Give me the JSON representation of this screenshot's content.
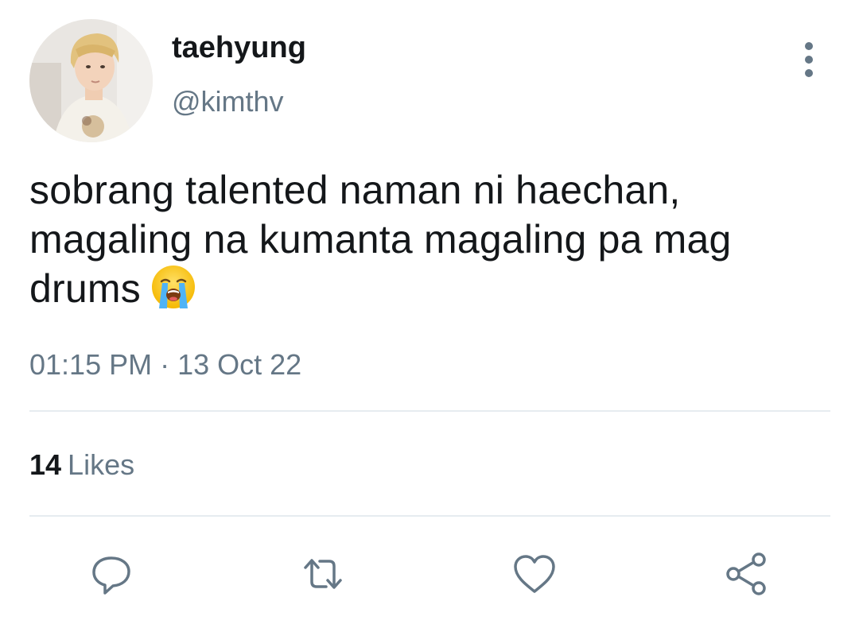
{
  "tweet": {
    "author": {
      "display_name": "taehyung",
      "handle": "@kimthv"
    },
    "text_lines": [
      "sobrang talented naman ni haechan,",
      "magaling na kumanta magaling pa mag",
      "drums"
    ],
    "emoji": "loudly-crying-face",
    "timestamp": "01:15 PM · 13 Oct 22",
    "likes": {
      "count": "14",
      "label": "Likes"
    },
    "actions": [
      "reply-icon",
      "retweet-icon",
      "like-icon",
      "share-icon"
    ]
  },
  "colors": {
    "text_primary": "#14171a",
    "text_secondary": "#657786",
    "divider": "#e6ecf0",
    "icon": "#657786"
  }
}
